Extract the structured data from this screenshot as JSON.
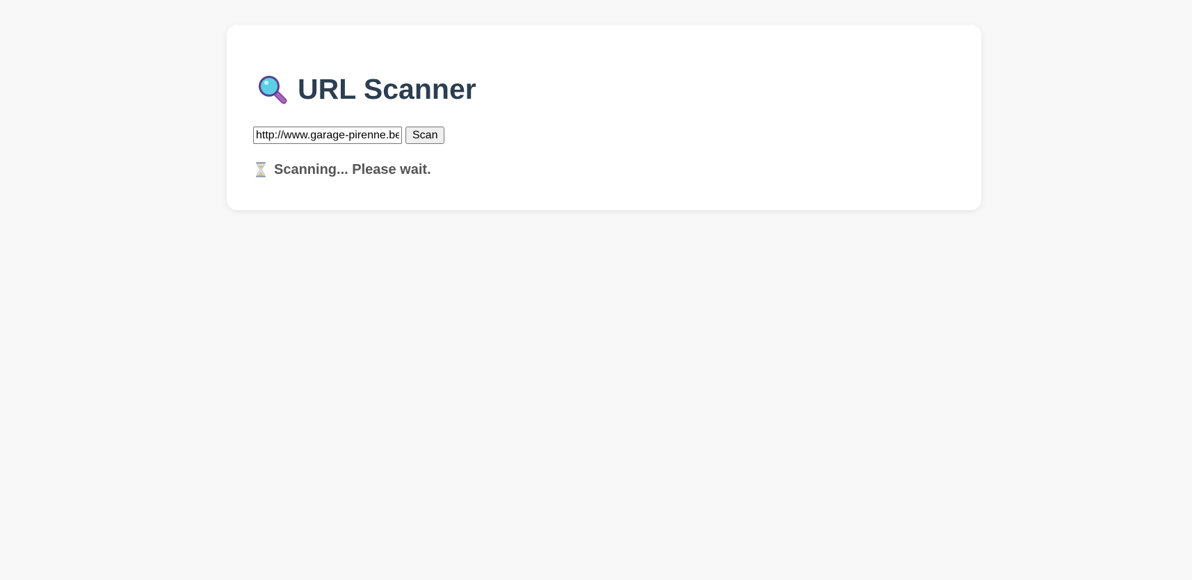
{
  "page": {
    "title": "URL Scanner",
    "title_icon": "magnifying-glass-icon"
  },
  "scanner": {
    "url_value": "http://www.garage-pirenne.be",
    "scan_label": "Scan"
  },
  "status": {
    "icon": "hourglass-icon",
    "text": "Scanning... Please wait."
  },
  "colors": {
    "background": "#f8f8f8",
    "card": "#ffffff",
    "title": "#2c3e50",
    "status_text": "#555555"
  }
}
